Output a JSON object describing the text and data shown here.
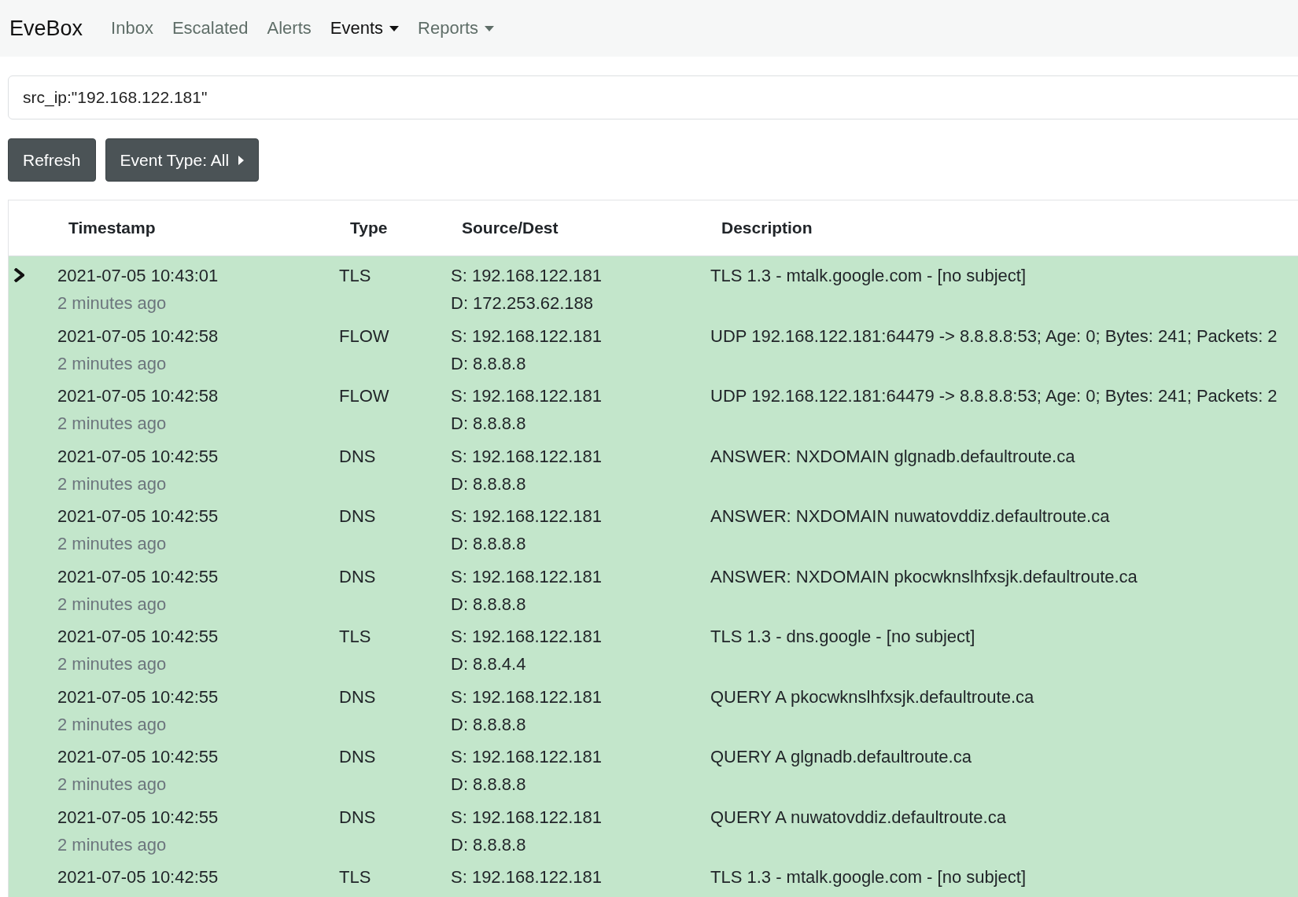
{
  "navbar": {
    "brand": "EveBox",
    "items": [
      {
        "label": "Inbox",
        "selected": false,
        "dropdown": false
      },
      {
        "label": "Escalated",
        "selected": false,
        "dropdown": false
      },
      {
        "label": "Alerts",
        "selected": false,
        "dropdown": false
      },
      {
        "label": "Events",
        "selected": true,
        "dropdown": true
      },
      {
        "label": "Reports",
        "selected": false,
        "dropdown": true
      }
    ]
  },
  "search": {
    "value": "src_ip:\"192.168.122.181\""
  },
  "buttons": [
    {
      "label": "Refresh",
      "kind": "plain"
    },
    {
      "label": "Event Type: All",
      "kind": "menu"
    }
  ],
  "table": {
    "columns": [
      "Timestamp",
      "Type",
      "Source/Dest",
      "Description"
    ],
    "rows": [
      {
        "selected": true,
        "timestamp": "2021-07-05 10:43:01",
        "ago": "2 minutes ago",
        "type": "TLS",
        "source": "S: 192.168.122.181",
        "dest": "D: 172.253.62.188",
        "description": "TLS 1.3 - mtalk.google.com - [no subject]"
      },
      {
        "selected": false,
        "timestamp": "2021-07-05 10:42:58",
        "ago": "2 minutes ago",
        "type": "FLOW",
        "source": "S: 192.168.122.181",
        "dest": "D: 8.8.8.8",
        "description": "UDP 192.168.122.181:64479 -> 8.8.8.8:53; Age: 0; Bytes: 241; Packets: 2"
      },
      {
        "selected": false,
        "timestamp": "2021-07-05 10:42:58",
        "ago": "2 minutes ago",
        "type": "FLOW",
        "source": "S: 192.168.122.181",
        "dest": "D: 8.8.8.8",
        "description": "UDP 192.168.122.181:64479 -> 8.8.8.8:53; Age: 0; Bytes: 241; Packets: 2"
      },
      {
        "selected": false,
        "timestamp": "2021-07-05 10:42:55",
        "ago": "2 minutes ago",
        "type": "DNS",
        "source": "S: 192.168.122.181",
        "dest": "D: 8.8.8.8",
        "description": "ANSWER: NXDOMAIN glgnadb.defaultroute.ca"
      },
      {
        "selected": false,
        "timestamp": "2021-07-05 10:42:55",
        "ago": "2 minutes ago",
        "type": "DNS",
        "source": "S: 192.168.122.181",
        "dest": "D: 8.8.8.8",
        "description": "ANSWER: NXDOMAIN nuwatovddiz.defaultroute.ca"
      },
      {
        "selected": false,
        "timestamp": "2021-07-05 10:42:55",
        "ago": "2 minutes ago",
        "type": "DNS",
        "source": "S: 192.168.122.181",
        "dest": "D: 8.8.8.8",
        "description": "ANSWER: NXDOMAIN pkocwknslhfxsjk.defaultroute.ca"
      },
      {
        "selected": false,
        "timestamp": "2021-07-05 10:42:55",
        "ago": "2 minutes ago",
        "type": "TLS",
        "source": "S: 192.168.122.181",
        "dest": "D: 8.8.4.4",
        "description": "TLS 1.3 - dns.google - [no subject]"
      },
      {
        "selected": false,
        "timestamp": "2021-07-05 10:42:55",
        "ago": "2 minutes ago",
        "type": "DNS",
        "source": "S: 192.168.122.181",
        "dest": "D: 8.8.8.8",
        "description": "QUERY A pkocwknslhfxsjk.defaultroute.ca"
      },
      {
        "selected": false,
        "timestamp": "2021-07-05 10:42:55",
        "ago": "2 minutes ago",
        "type": "DNS",
        "source": "S: 192.168.122.181",
        "dest": "D: 8.8.8.8",
        "description": "QUERY A glgnadb.defaultroute.ca"
      },
      {
        "selected": false,
        "timestamp": "2021-07-05 10:42:55",
        "ago": "2 minutes ago",
        "type": "DNS",
        "source": "S: 192.168.122.181",
        "dest": "D: 8.8.8.8",
        "description": "QUERY A nuwatovddiz.defaultroute.ca"
      },
      {
        "selected": false,
        "timestamp": "2021-07-05 10:42:55",
        "type": "TLS",
        "source": "S: 192.168.122.181",
        "description": "TLS 1.3 - mtalk.google.com - [no subject]"
      }
    ]
  }
}
